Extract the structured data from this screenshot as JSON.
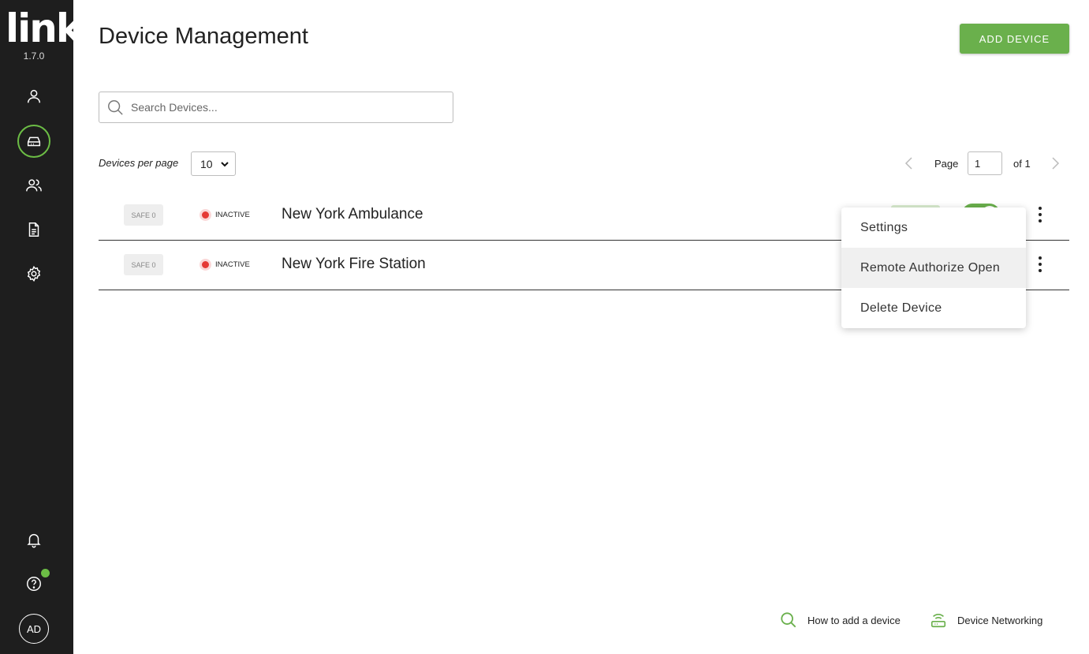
{
  "app": {
    "logo_text": "link",
    "version": "1.7.0",
    "avatar_initials": "AD",
    "accent_color": "#6ab04c"
  },
  "sidebar": {
    "items": [
      {
        "icon": "user-icon",
        "active": false
      },
      {
        "icon": "device-icon",
        "active": true
      },
      {
        "icon": "users-icon",
        "active": false
      },
      {
        "icon": "document-icon",
        "active": false
      },
      {
        "icon": "gear-icon",
        "active": false
      }
    ],
    "bottom": [
      {
        "icon": "bell-icon"
      },
      {
        "icon": "help-icon",
        "badge": true
      }
    ]
  },
  "header": {
    "title": "Device Management",
    "add_button_label": "ADD DEVICE"
  },
  "search": {
    "placeholder": "Search Devices...",
    "value": ""
  },
  "pagination": {
    "per_page_label": "Devices per page",
    "per_page_value": "10",
    "page_label": "Page",
    "current_page": "1",
    "of_label": "of 1"
  },
  "devices": [
    {
      "safe_label": "SAFE 0",
      "status": "INACTIVE",
      "status_color": "#e53935",
      "name": "New York Ambulance",
      "toggle_on": true
    },
    {
      "safe_label": "SAFE 0",
      "status": "INACTIVE",
      "status_color": "#e53935",
      "name": "New York Fire Station",
      "toggle_on": false
    }
  ],
  "context_menu": {
    "items": [
      "Settings",
      "Remote Authorize Open",
      "Delete Device"
    ],
    "hovered_index": 1
  },
  "footer": {
    "how_to_add": "How to add a device",
    "networking": "Device Networking"
  }
}
